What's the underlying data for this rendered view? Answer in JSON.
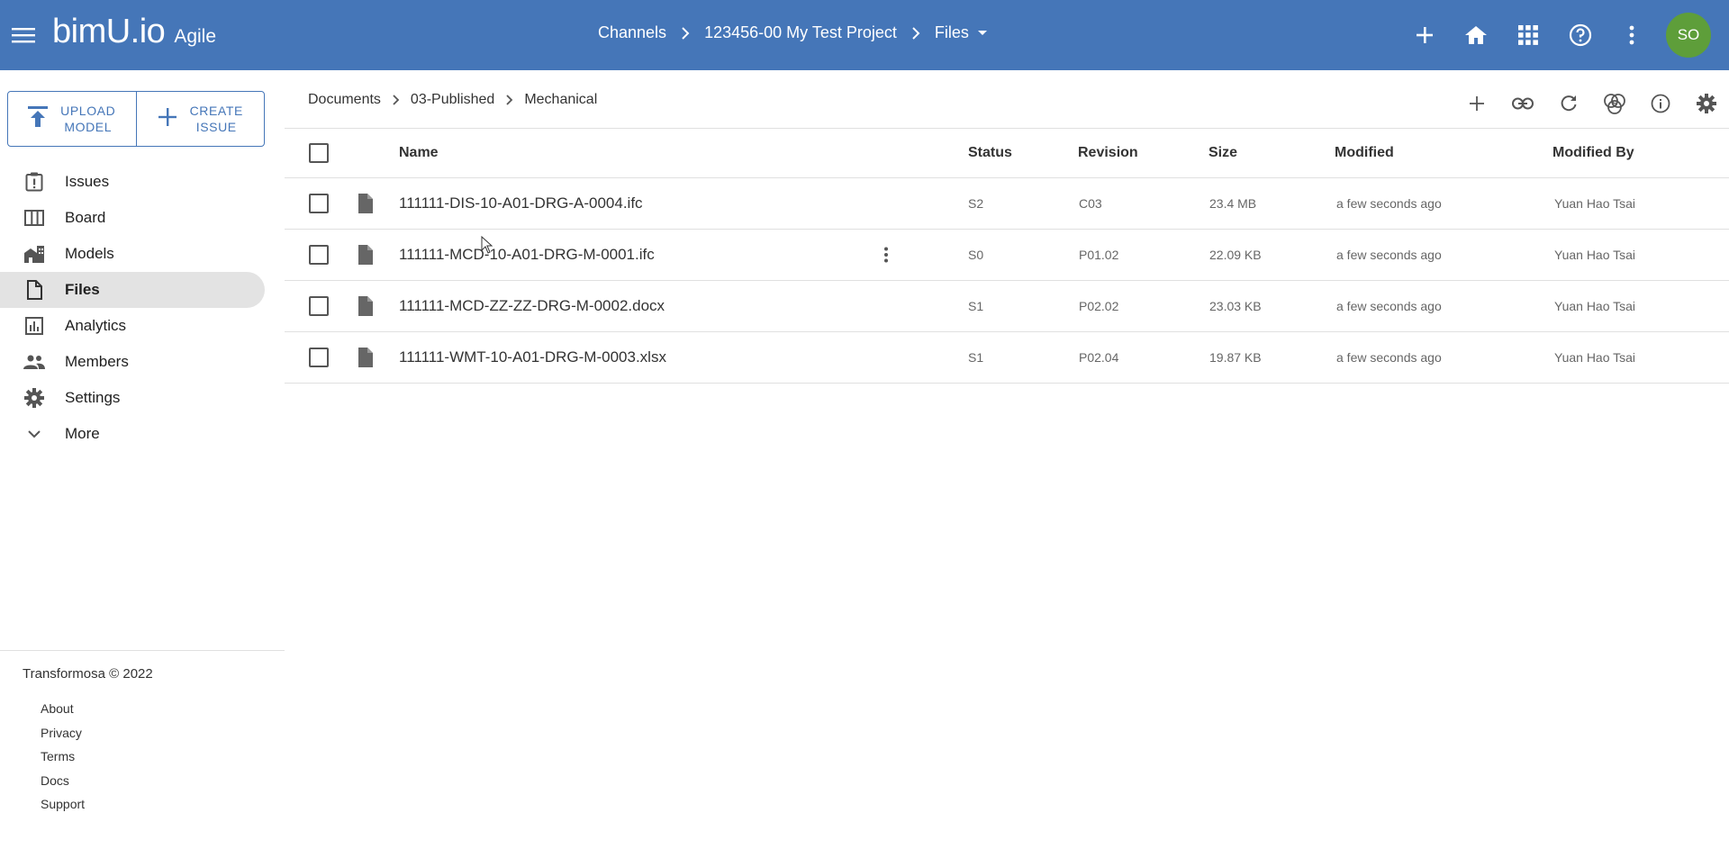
{
  "header": {
    "brand": "bimU.io",
    "edition": "Agile",
    "breadcrumbs": [
      "Channels",
      "123456-00 My Test Project",
      "Files"
    ],
    "avatar_initials": "SO",
    "avatar_color": "#5e9e3a",
    "bar_color": "#4576b8",
    "icons": [
      "add-icon",
      "home-icon",
      "apps-icon",
      "help-icon",
      "more-vert-icon"
    ]
  },
  "sidebar": {
    "actions": [
      {
        "line1": "UPLOAD",
        "line2": "MODEL",
        "icon": "upload-icon"
      },
      {
        "line1": "CREATE",
        "line2": "ISSUE",
        "icon": "add-icon"
      }
    ],
    "items": [
      {
        "label": "Issues",
        "icon": "issue-icon"
      },
      {
        "label": "Board",
        "icon": "board-icon"
      },
      {
        "label": "Models",
        "icon": "models-icon"
      },
      {
        "label": "Files",
        "icon": "file-icon",
        "active": true
      },
      {
        "label": "Analytics",
        "icon": "analytics-icon"
      },
      {
        "label": "Members",
        "icon": "members-icon"
      },
      {
        "label": "Settings",
        "icon": "gear-icon"
      },
      {
        "label": "More",
        "icon": "chevron-down-icon"
      }
    ],
    "copyright": "Transformosa © 2022",
    "footer_links": [
      "About",
      "Privacy",
      "Terms",
      "Docs",
      "Support"
    ]
  },
  "main": {
    "breadcrumbs": [
      "Documents",
      "03-Published",
      "Mechanical"
    ],
    "toolbar_icons": [
      "add-icon",
      "link-icon",
      "refresh-icon",
      "status-filter-icon",
      "info-icon",
      "gear-icon"
    ],
    "columns": [
      "Name",
      "Status",
      "Revision",
      "Size",
      "Modified",
      "Modified By"
    ],
    "rows": [
      {
        "name": "111111-DIS-10-A01-DRG-A-0004.ifc",
        "status": "S2",
        "revision": "C03",
        "size": "23.4 MB",
        "modified": "a few seconds ago",
        "modified_by": "Yuan Hao Tsai"
      },
      {
        "name": "111111-MCD-10-A01-DRG-M-0001.ifc",
        "status": "S0",
        "revision": "P01.02",
        "size": "22.09 KB",
        "modified": "a few seconds ago",
        "modified_by": "Yuan Hao Tsai"
      },
      {
        "name": "111111-MCD-ZZ-ZZ-DRG-M-0002.docx",
        "status": "S1",
        "revision": "P02.02",
        "size": "23.03 KB",
        "modified": "a few seconds ago",
        "modified_by": "Yuan Hao Tsai"
      },
      {
        "name": "111111-WMT-10-A01-DRG-M-0003.xlsx",
        "status": "S1",
        "revision": "P02.04",
        "size": "19.87 KB",
        "modified": "a few seconds ago",
        "modified_by": "Yuan Hao Tsai"
      }
    ]
  }
}
